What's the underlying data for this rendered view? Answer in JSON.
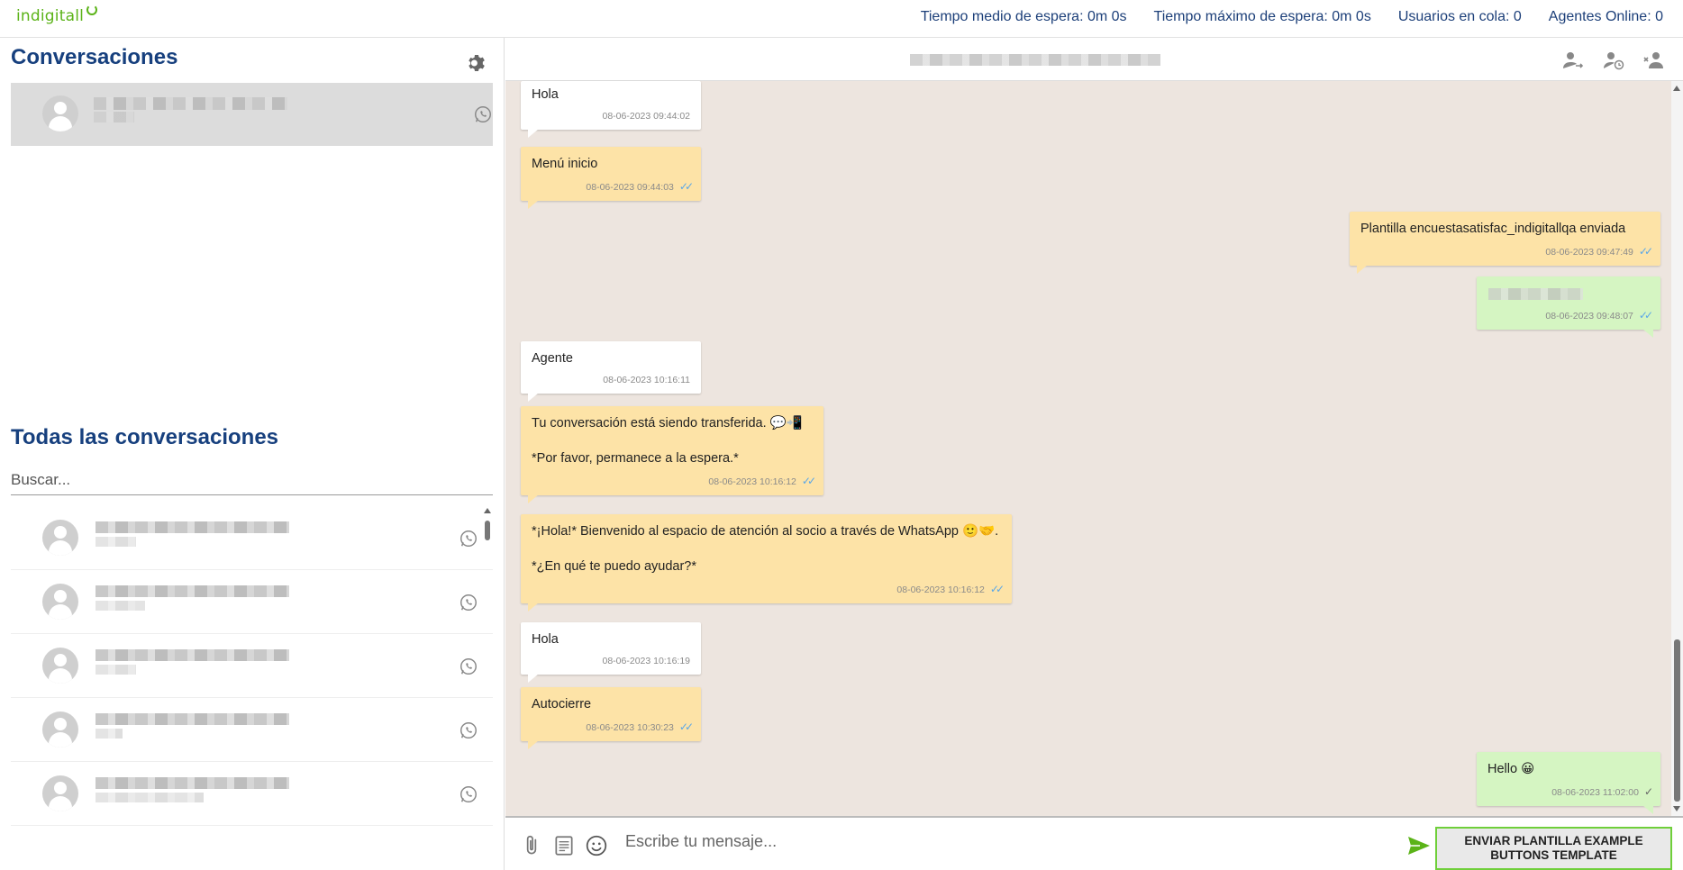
{
  "brand": {
    "name": "indigitall"
  },
  "topbar": {
    "wait_avg": "Tiempo medio de espera: 0m 0s",
    "wait_max": "Tiempo máximo de espera: 0m 0s",
    "queue": "Usuarios en cola: 0",
    "agents": "Agentes Online: 0"
  },
  "left": {
    "conversations_title": "Conversaciones",
    "all_title": "Todas las conversaciones",
    "search_placeholder": "Buscar..."
  },
  "icons": {
    "settings": "gear-icon",
    "channel": "whatsapp-icon",
    "avatar": "user-avatar-icon",
    "transfer": "transfer-user-icon",
    "snooze": "user-clock-icon",
    "close": "remove-user-icon",
    "attach": "paperclip-icon",
    "template": "document-icon",
    "emoji": "smiley-icon",
    "send": "send-icon"
  },
  "messages": [
    {
      "type": "in",
      "text": "Hola",
      "time": "08-06-2023 09:44:02",
      "ticks": ""
    },
    {
      "type": "bot",
      "text": "Menú inicio",
      "time": "08-06-2023 09:44:03",
      "ticks": "✓✓"
    },
    {
      "type": "out-bot",
      "text": "Plantilla encuestasatisfac_indigitallqa enviada",
      "time": "08-06-2023 09:47:49",
      "ticks": "✓✓"
    },
    {
      "type": "out",
      "text": "",
      "time": "08-06-2023 09:48:07",
      "ticks": "✓✓"
    },
    {
      "type": "in",
      "text": "Agente",
      "time": "08-06-2023 10:16:11",
      "ticks": ""
    },
    {
      "type": "bot",
      "text": "Tu conversación está siendo transferida. 💬📲\n\n*Por favor, permanece a la espera.*",
      "time": "08-06-2023 10:16:12",
      "ticks": "✓✓"
    },
    {
      "type": "bot",
      "text": "*¡Hola!* Bienvenido al espacio de atención al socio a través de WhatsApp 🙂🤝.\n\n*¿En qué te puedo ayudar?*",
      "time": "08-06-2023 10:16:12",
      "ticks": "✓✓"
    },
    {
      "type": "in",
      "text": "Hola",
      "time": "08-06-2023 10:16:19",
      "ticks": ""
    },
    {
      "type": "bot",
      "text": "Autocierre",
      "time": "08-06-2023 10:30:23",
      "ticks": "✓✓"
    },
    {
      "type": "out",
      "text": "Hello 😀",
      "time": "08-06-2023 11:02:00",
      "ticks": "✓"
    }
  ],
  "composer": {
    "placeholder": "Escribe tu mensaje...",
    "template_button": "ENVIAR PLANTILLA EXAMPLE BUTTONS TEMPLATE"
  },
  "colors": {
    "brand_green": "#5bb318",
    "title_blue": "#17407e",
    "chat_bg": "#ede5df",
    "bubble_yellow": "#fde3a7",
    "bubble_green": "#d5f5c2",
    "tick_blue": "#5aa7e8"
  }
}
